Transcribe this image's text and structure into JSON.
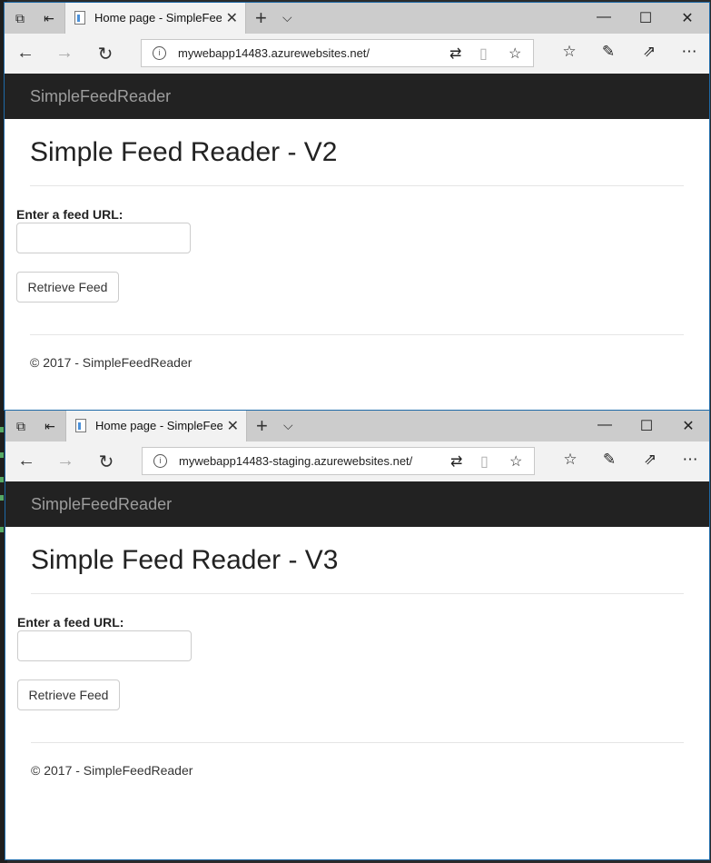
{
  "windows": [
    {
      "tab_title": "Home page - SimpleFeedReader",
      "url": "mywebapp14483.azurewebsites.net/",
      "brand": "SimpleFeedReader",
      "heading": "Simple Feed Reader - V2",
      "feed_label": "Enter a feed URL:",
      "feed_input_value": "",
      "retrieve_button": "Retrieve Feed",
      "footer": "© 2017 - SimpleFeedReader"
    },
    {
      "tab_title": "Home page - SimpleFeedReader",
      "url": "mywebapp14483-staging.azurewebsites.net/",
      "brand": "SimpleFeedReader",
      "heading": "Simple Feed Reader - V3",
      "feed_label": "Enter a feed URL:",
      "feed_input_value": "",
      "retrieve_button": "Retrieve Feed",
      "footer": "© 2017 - SimpleFeedReader"
    }
  ],
  "icons": {
    "tabs_aside": "tabs-aside-icon",
    "set_tabs_aside": "set-tabs-aside-icon",
    "back": "back-arrow-icon",
    "forward": "forward-arrow-icon",
    "refresh": "refresh-icon",
    "info": "info-icon",
    "translate": "translate-icon",
    "reading_view": "reading-view-icon",
    "favorite": "star-icon",
    "favorites_hub": "favorites-hub-icon",
    "notes": "pen-icon",
    "share": "share-icon",
    "more": "more-icon"
  },
  "colors": {
    "navbar_bg": "#222222",
    "brand_text": "#9d9d9d",
    "window_border": "#1e6aa8"
  }
}
